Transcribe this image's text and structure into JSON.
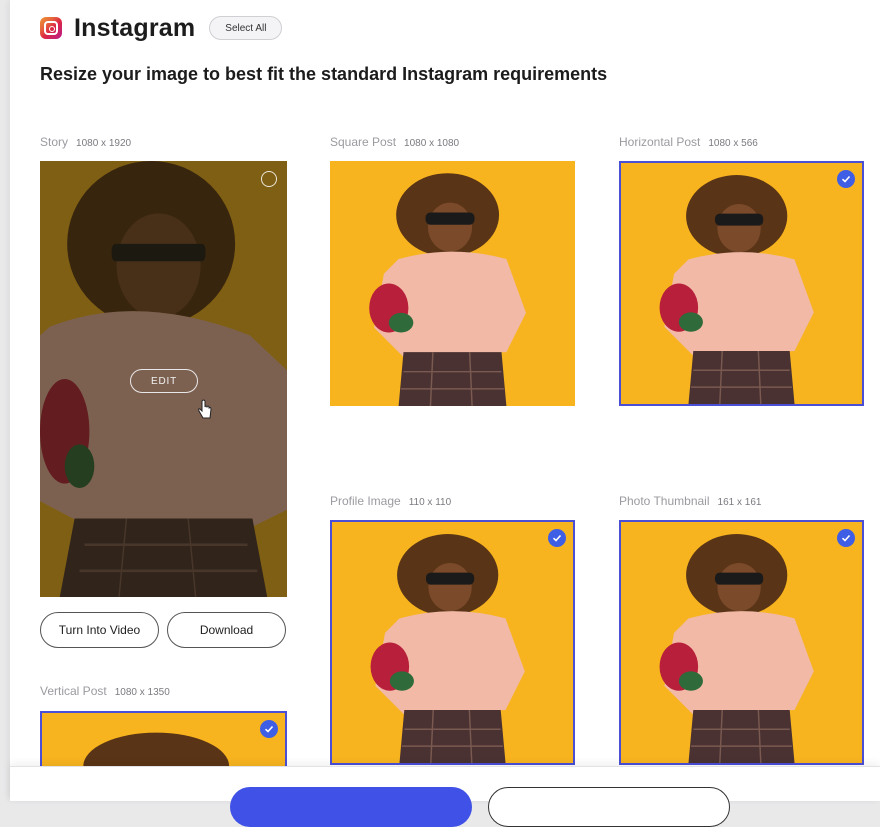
{
  "header": {
    "title": "Instagram",
    "select_all_label": "Select All",
    "subtitle": "Resize your image to best fit the standard Instagram requirements"
  },
  "cards": {
    "story": {
      "name": "Story",
      "dims": "1080 x 1920",
      "selected": false,
      "edit_label": "EDIT"
    },
    "square_post": {
      "name": "Square Post",
      "dims": "1080 x 1080",
      "selected": false
    },
    "horizontal_post": {
      "name": "Horizontal Post",
      "dims": "1080 x 566",
      "selected": true
    },
    "profile_image": {
      "name": "Profile Image",
      "dims": "110 x 110",
      "selected": true
    },
    "photo_thumbnail": {
      "name": "Photo Thumbnail",
      "dims": "161 x 161",
      "selected": true
    },
    "vertical_post": {
      "name": "Vertical Post",
      "dims": "1080 x 1350",
      "selected": true
    }
  },
  "story_actions": {
    "turn_into_video": "Turn Into Video",
    "download": "Download"
  },
  "colors": {
    "accent": "#3f51e6",
    "selected_border": "#4a4fd6",
    "photo_background": "#f7b41f"
  },
  "icons": {
    "brand": "instagram-icon",
    "check": "check-icon",
    "cursor": "hand-cursor-icon"
  }
}
